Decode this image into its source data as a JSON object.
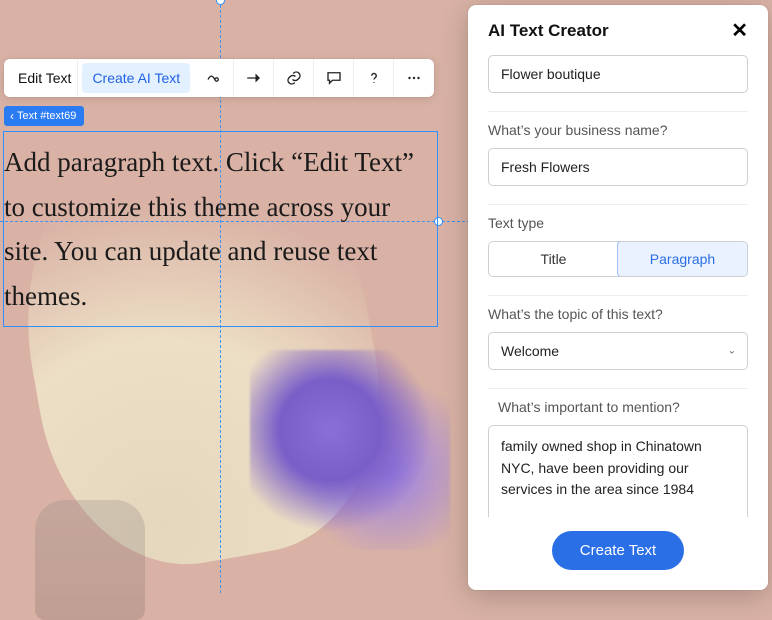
{
  "toolbar": {
    "edit_label": "Edit Text",
    "create_ai_label": "Create AI Text"
  },
  "element_tag": "Text #text69",
  "textbox_content": "Add paragraph text. Click “Edit Text” to customize this theme across your site. You can update and reuse text themes.",
  "panel": {
    "title": "AI Text Creator",
    "business_type_value": "Flower boutique",
    "business_name_label": "What’s your business name?",
    "business_name_value": "Fresh Flowers",
    "text_type_label": "Text type",
    "text_type_options": {
      "title": "Title",
      "paragraph": "Paragraph"
    },
    "topic_label": "What’s the topic of this text?",
    "topic_value": "Welcome",
    "important_label": "What’s important to mention?",
    "important_value": "family owned shop in Chinatown NYC, have been providing our services in the area since 1984",
    "submit_label": "Create Text"
  }
}
